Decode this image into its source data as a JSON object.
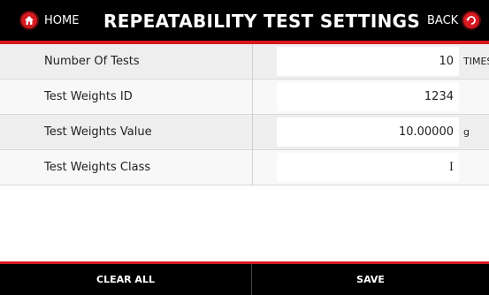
{
  "header": {
    "home_label": "HOME",
    "title": "REPEATABILITY TEST SETTINGS",
    "back_label": "BACK",
    "home_icon": "home-icon",
    "back_icon": "back-icon"
  },
  "colors": {
    "accent": "#d71920",
    "header_bg": "#000000",
    "row_alt_bg": "#eeeeee",
    "row_plain_bg": "#f8f8f8",
    "text": "#222222"
  },
  "rows": [
    {
      "label": "Number Of Tests",
      "value": "10",
      "unit": "TIMES"
    },
    {
      "label": "Test Weights ID",
      "value": "1234",
      "unit": ""
    },
    {
      "label": "Test Weights Value",
      "value": "10.00000",
      "unit": "g"
    },
    {
      "label": "Test Weights Class",
      "value": "I",
      "unit": ""
    }
  ],
  "footer": {
    "clear_label": "CLEAR ALL",
    "save_label": "SAVE"
  }
}
